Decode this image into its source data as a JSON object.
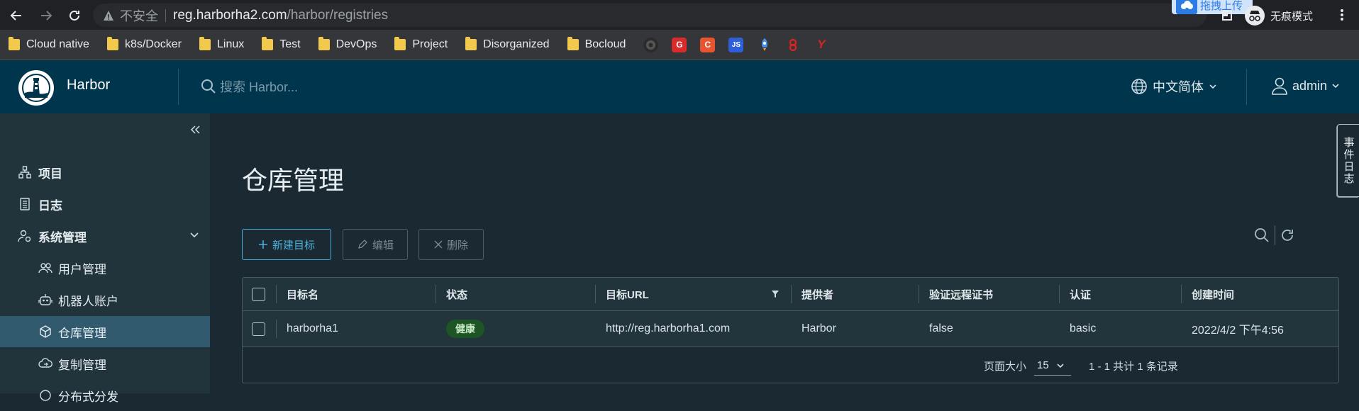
{
  "browser": {
    "insecure_label": "不安全",
    "url_host": "reg.harborha2.com",
    "url_path": "/harbor/registries",
    "upload_label": "拖拽上传",
    "incognito_label": "无痕模式"
  },
  "bookmarks": {
    "folders": [
      "Cloud native",
      "k8s/Docker",
      "Linux",
      "Test",
      "DevOps",
      "Project",
      "Disorganized",
      "Bocloud"
    ],
    "icons": [
      {
        "name": "github-icon",
        "glyph": "",
        "color": "#2b2b2b"
      },
      {
        "name": "g-icon",
        "glyph": "G",
        "color": "#d92b2b"
      },
      {
        "name": "c-icon",
        "glyph": "C",
        "color": "#e8542f"
      },
      {
        "name": "js-icon",
        "glyph": "JS",
        "color": "#2f5fd8"
      },
      {
        "name": "rocket-icon",
        "glyph": "",
        "color": "#3b7ddd"
      },
      {
        "name": "logo-red-icon",
        "glyph": "",
        "color": "#d82323"
      },
      {
        "name": "y-icon",
        "glyph": "Y",
        "color": "#d82323"
      }
    ]
  },
  "header": {
    "brand": "Harbor",
    "search_placeholder": "搜索 Harbor...",
    "language": "中文简体",
    "user": "admin"
  },
  "sidebar": {
    "items": [
      {
        "label": "项目",
        "icon": "projects-icon"
      },
      {
        "label": "日志",
        "icon": "logs-icon"
      },
      {
        "label": "系统管理",
        "icon": "admin-icon"
      },
      {
        "label": "用户管理",
        "icon": "users-icon"
      },
      {
        "label": "机器人账户",
        "icon": "robot-icon"
      },
      {
        "label": "仓库管理",
        "icon": "registry-icon"
      },
      {
        "label": "复制管理",
        "icon": "replication-icon"
      },
      {
        "label": "分布式分发",
        "icon": "distribution-icon"
      }
    ]
  },
  "main": {
    "title": "仓库管理",
    "new_button": "新建目标",
    "edit_button": "编辑",
    "delete_button": "删除",
    "columns": [
      "目标名",
      "状态",
      "目标URL",
      "提供者",
      "验证远程证书",
      "认证",
      "创建时间"
    ],
    "rows": [
      {
        "name": "harborha1",
        "status": "健康",
        "url": "http://reg.harborha1.com",
        "provider": "Harbor",
        "verify": "false",
        "auth": "basic",
        "created": "2022/4/2 下午4:56"
      }
    ],
    "footer": {
      "page_size_label": "页面大小",
      "page_size": "15",
      "count": "1 - 1 共计 1 条记录"
    }
  },
  "side_tab": "事件日志",
  "colors": {
    "header_bg": "#00364d",
    "sidebar_bg": "#21333b",
    "main_bg": "#1b2a32",
    "accent": "#49afd9",
    "active_item": "#325a6f",
    "healthy_badge": "#1e5525"
  }
}
